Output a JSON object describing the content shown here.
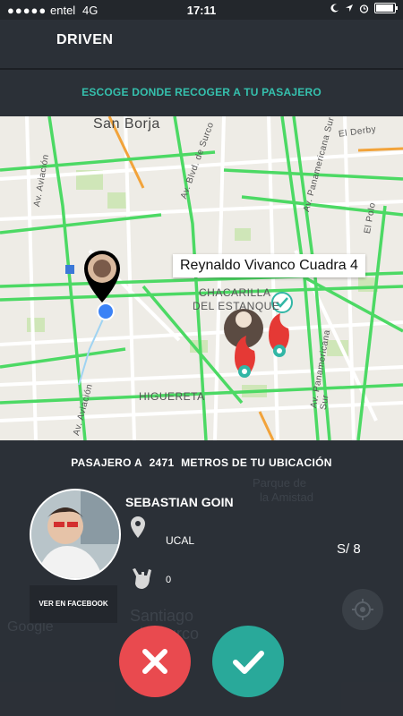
{
  "status_bar": {
    "signal": "●●●●●",
    "carrier": "entel",
    "network": "4G",
    "time": "17:11",
    "icons": [
      "moon-icon",
      "location-arrow-icon",
      "alarm-icon",
      "battery-icon"
    ]
  },
  "header": {
    "title": "DRIVEN"
  },
  "instruction": "ESCOGE DONDE RECOGER A TU PASAJERO",
  "map": {
    "labels": {
      "san_borja": "San Borja",
      "chacarilla_1": "CHACARILLA",
      "chacarilla_2": "DEL ESTANQUE",
      "higuereta": "HIGUERETA",
      "av_aviacion": "Av. Aviación",
      "av_aviacion_2": "Av. Aviación",
      "av_surco": "Av. Blvd. de Surco",
      "panamericana_1": "Av. Panamericana Sur",
      "panamericana_2": "Av. Panamericana Sur",
      "el_derby": "El Derby",
      "el_polo": "El Polo"
    },
    "tooltip": "Reynaldo Vivanco Cuadra 4",
    "colors": {
      "road": "#ffffff",
      "traffic": "#4cd964",
      "arterial": "#f2a33a",
      "park": "#cfe6b8"
    }
  },
  "panel": {
    "distance_prefix": "PASAJERO A",
    "distance_value": "2471",
    "distance_suffix": "METROS DE TU UBICACIÓN",
    "passenger_name": "SEBASTIAN GOIN",
    "university": "UCAL",
    "likes": "0",
    "seats": "S/ 8",
    "facebook_button": "VER EN FACEBOOK",
    "background_labels": {
      "parque_1": "Parque de",
      "parque_2": "la Amistad",
      "santiago_1": "Santiago",
      "santiago_2": "de Surco",
      "google": "Google"
    }
  },
  "actions": {
    "reject": "close-icon",
    "accept": "check-icon"
  },
  "theme": {
    "accent": "#35c0ad",
    "reject": "#e94a4f",
    "accept": "#29a99a",
    "header_bg": "#2b3037"
  }
}
